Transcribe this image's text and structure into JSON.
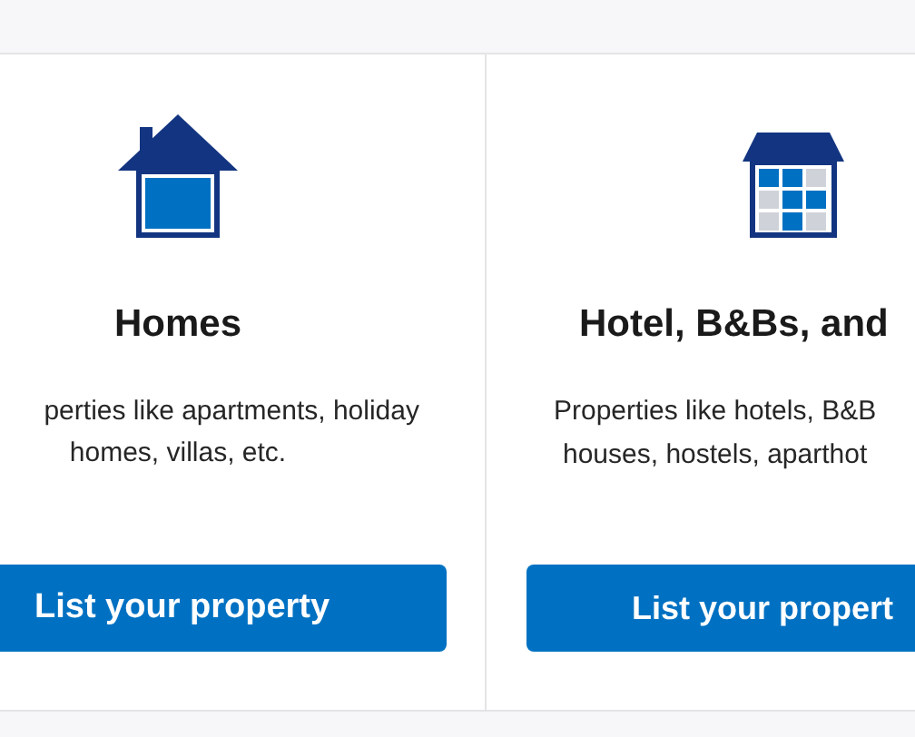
{
  "cards": [
    {
      "kind": "house",
      "title": "Homes",
      "description_lines": [
        "perties like apartments, holiday",
        "homes, villas, etc."
      ],
      "button": "List your property"
    },
    {
      "kind": "hotel",
      "title": "Hotel, B&Bs, and",
      "description_lines": [
        "Properties like hotels, B&B",
        "houses, hostels, aparthot"
      ],
      "button": "List your propert"
    }
  ]
}
